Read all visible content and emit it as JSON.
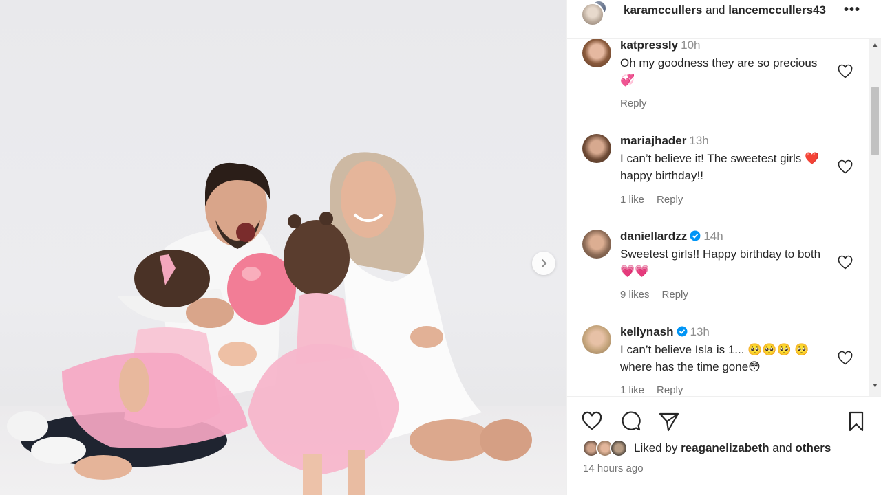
{
  "header": {
    "user1": "karamccullers",
    "conjunction": "and",
    "user2": "lancemccullers43",
    "more": "•••"
  },
  "comments": [
    {
      "username": "katpressly",
      "time": "10h",
      "verified": false,
      "text": "Oh my goodness they are so precious 💞",
      "likes": "",
      "reply": "Reply"
    },
    {
      "username": "mariajhader",
      "time": "13h",
      "verified": false,
      "text": "I can’t believe it! The sweetest girls ❤️ happy birthday!!",
      "likes": "1 like",
      "reply": "Reply"
    },
    {
      "username": "daniellardzz",
      "time": "14h",
      "verified": true,
      "text": "Sweetest girls!! Happy birthday to both 💗💗",
      "likes": "9 likes",
      "reply": "Reply"
    },
    {
      "username": "kellynash",
      "time": "13h",
      "verified": true,
      "text": "I can’t believe Isla is 1... 🥺🥺🥺 🥺 where has the time gone😳",
      "likes": "1 like",
      "reply": "Reply"
    }
  ],
  "likes": {
    "prefix": "Liked by",
    "user": "reaganelizabeth",
    "conjunction": "and",
    "others": "others"
  },
  "posted": "14 hours ago",
  "colors": {
    "verified": "#0095f6",
    "text": "#262626",
    "muted": "#737373"
  }
}
